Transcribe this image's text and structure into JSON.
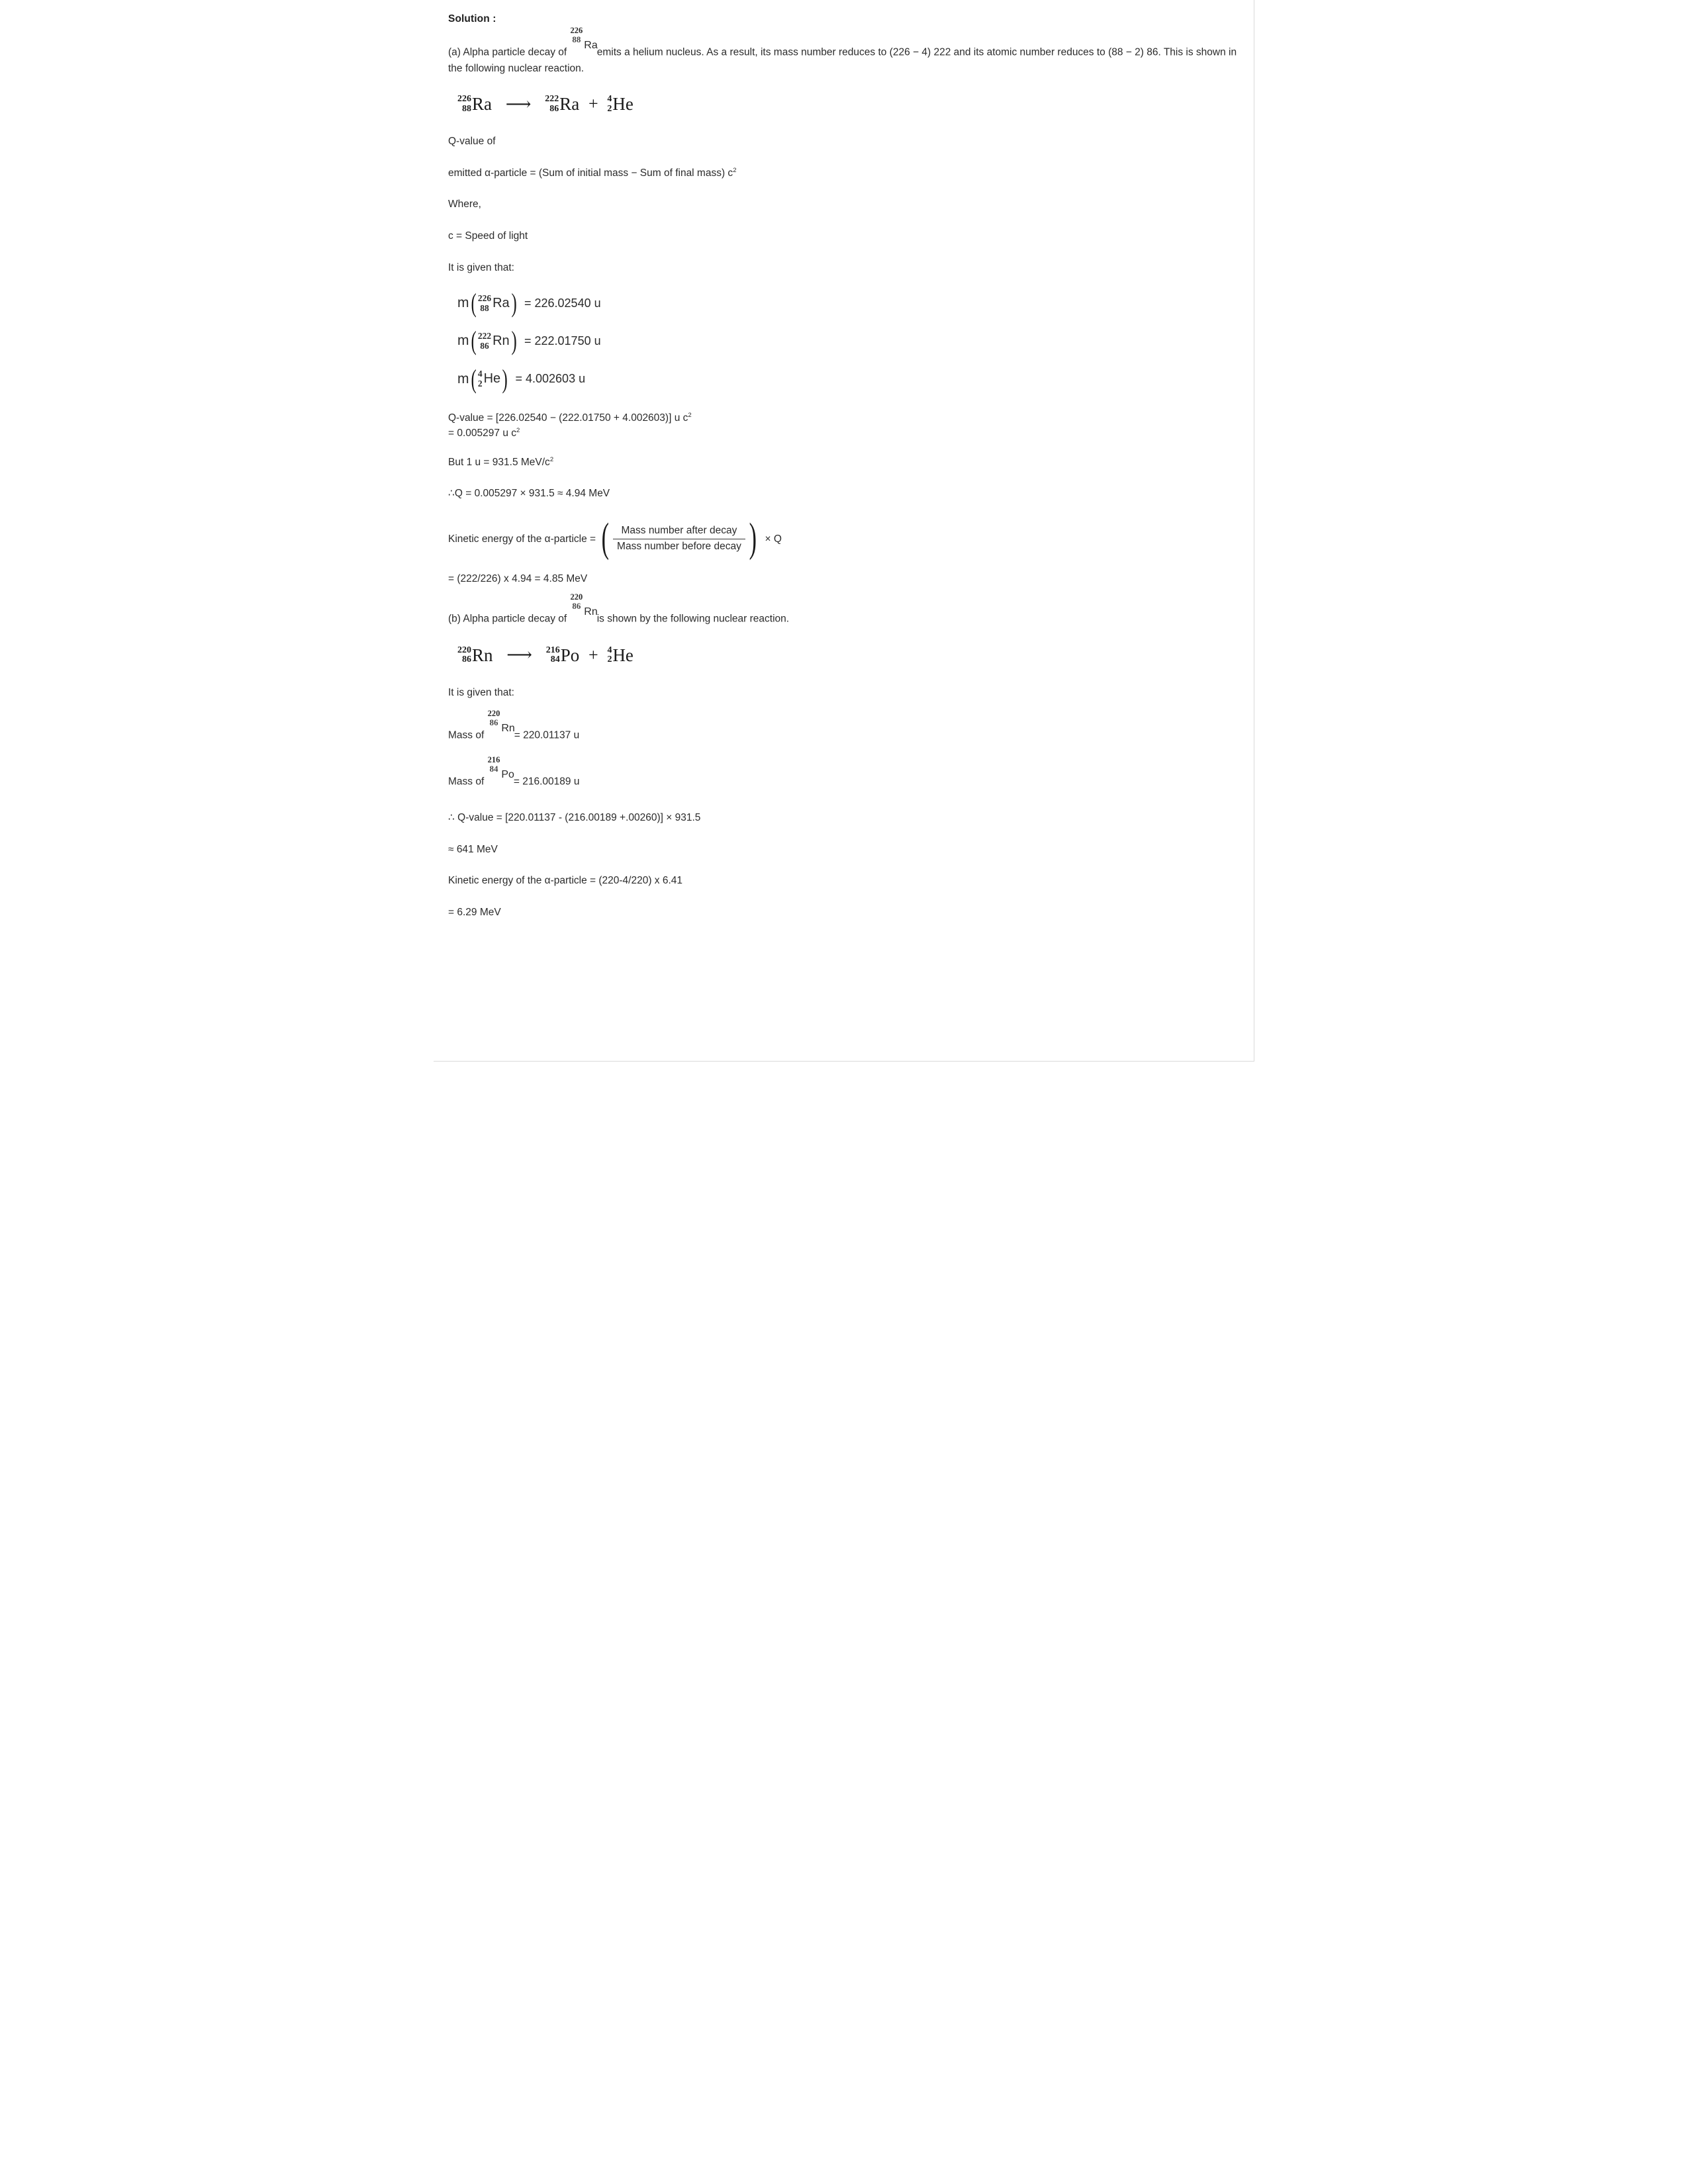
{
  "document": {
    "heading": "Solution :",
    "part_a": {
      "intro_prefix": "(a) Alpha particle decay of",
      "intro_nuclide": {
        "a": "226",
        "z": "88",
        "symbol": "Ra"
      },
      "intro_suffix": "emits a helium nucleus. As a result, its mass number reduces to (226 − 4) 222 and its atomic number reduces to (88 − 2) 86. This is shown in the following nuclear reaction.",
      "reaction": {
        "reactant": {
          "a": "226",
          "z": "88",
          "symbol": "Ra"
        },
        "arrow": "⟶",
        "product1": {
          "a": "222",
          "z": "86",
          "symbol": "Ra"
        },
        "plus": "+",
        "product2": {
          "a": "4",
          "z": "2",
          "symbol": "He"
        }
      },
      "qvalue_label": "Q-value of",
      "qvalue_def": "emitted α-particle = (Sum of initial mass − Sum of final mass) c",
      "qvalue_def_exp": "2",
      "where_label": "Where,",
      "c_def": "c = Speed of light",
      "given_label": "It is given that:",
      "masses": [
        {
          "a": "226",
          "z": "88",
          "symbol": "Ra",
          "value": "= 226.02540 u"
        },
        {
          "a": "222",
          "z": "86",
          "symbol": "Rn",
          "value": "= 222.01750 u"
        },
        {
          "a": "4",
          "z": "2",
          "symbol": "He",
          "value": "= 4.002603 u"
        }
      ],
      "calc_line1": "Q-value = [226.02540 − (222.01750 + 4.002603)] u c",
      "calc_line1_exp": "2",
      "calc_line2": "= 0.005297 u c",
      "calc_line2_exp": "2",
      "unit_conv": "But 1 u = 931.5 MeV/c",
      "unit_conv_exp": "2",
      "q_result": "∴Q = 0.005297 × 931.5 ≈ 4.94 MeV",
      "ke_lead": "Kinetic energy of the α-particle =",
      "ke_frac_num": "Mass number after decay",
      "ke_frac_den": "Mass number before decay",
      "ke_times": "× Q",
      "ke_result": " = (222/226) x 4.94 = 4.85 MeV"
    },
    "part_b": {
      "intro_prefix": "(b) Alpha particle decay of",
      "intro_nuclide": {
        "a": "220",
        "z": "86",
        "symbol": "Rn"
      },
      "intro_suffix": "is shown by the following nuclear reaction.",
      "reaction": {
        "reactant": {
          "a": "220",
          "z": "86",
          "symbol": "Rn"
        },
        "arrow": "⟶",
        "product1": {
          "a": "216",
          "z": "84",
          "symbol": "Po"
        },
        "plus": "+",
        "product2": {
          "a": "4",
          "z": "2",
          "symbol": "He"
        }
      },
      "given_label": "It is given that:",
      "mass_rn_prefix": "Mass of",
      "mass_rn_nuclide": {
        "a": "220",
        "z": "86",
        "symbol": "Rn"
      },
      "mass_rn_value": "= 220.01137 u",
      "mass_po_prefix": "Mass of",
      "mass_po_nuclide": {
        "a": "216",
        "z": "84",
        "symbol": "Po"
      },
      "mass_po_value": "= 216.00189 u",
      "qvalue_calc": "∴ Q-value = [220.01137 - (216.00189 +.00260)] × 931.5",
      "q_result": "≈ 641 MeV",
      "ke_line": "Kinetic energy of the α-particle  = (220-4/220) x 6.41",
      "ke_result": "= 6.29 MeV"
    }
  },
  "style": {
    "text_color": "#2b2b2b",
    "heading_color": "#1d1d1d",
    "background": "#ffffff"
  }
}
